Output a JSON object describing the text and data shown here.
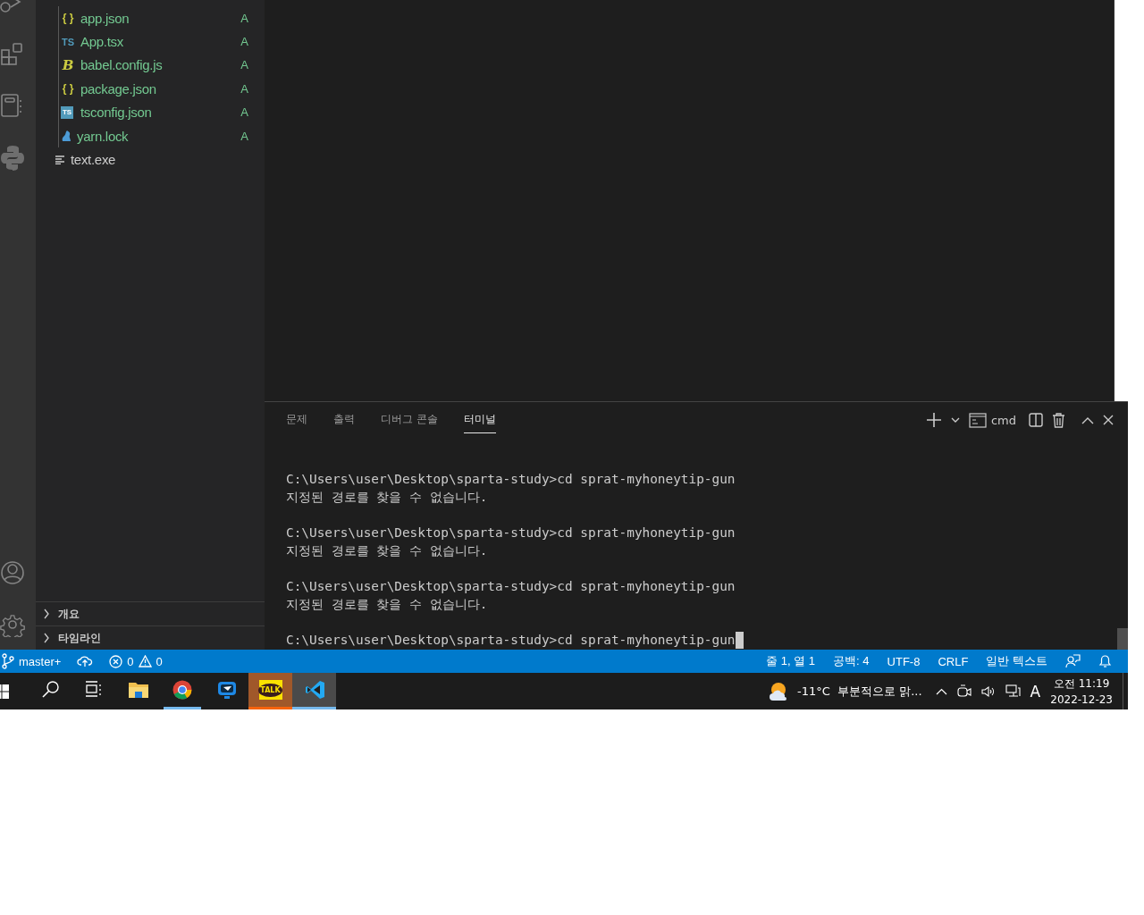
{
  "explorer": {
    "files": [
      {
        "name": "app.json",
        "kind": "json",
        "icon_text": "{ }",
        "git_status": "A"
      },
      {
        "name": "App.tsx",
        "kind": "ts",
        "icon_text": "TS",
        "git_status": "A"
      },
      {
        "name": "babel.config.js",
        "kind": "babel",
        "icon_text": "B",
        "git_status": "A"
      },
      {
        "name": "package.json",
        "kind": "json",
        "icon_text": "{ }",
        "git_status": "A"
      },
      {
        "name": "tsconfig.json",
        "kind": "tsconfig",
        "icon_text": "TS",
        "git_status": "A"
      },
      {
        "name": "yarn.lock",
        "kind": "yarn",
        "git_status": "A"
      }
    ],
    "root_files": [
      {
        "name": "text.exe",
        "kind": "text"
      }
    ],
    "sections": [
      {
        "label": "개요",
        "expanded": false
      },
      {
        "label": "타임라인",
        "expanded": false
      }
    ]
  },
  "panel": {
    "tabs": [
      {
        "label": "문제",
        "selected": false
      },
      {
        "label": "출력",
        "selected": false
      },
      {
        "label": "디버그 콘솔",
        "selected": false
      },
      {
        "label": "터미널",
        "selected": true
      }
    ],
    "shell": "cmd",
    "terminal_lines": [
      {
        "kind": "command",
        "text": "C:\\Users\\user\\Desktop\\sparta-study>cd sprat-myhoneytip-gun"
      },
      {
        "kind": "output",
        "text": "지정된 경로를 찾을 수 없습니다."
      },
      {
        "kind": "command",
        "text": "C:\\Users\\user\\Desktop\\sparta-study>cd sprat-myhoneytip-gun"
      },
      {
        "kind": "output",
        "text": "지정된 경로를 찾을 수 없습니다."
      },
      {
        "kind": "command",
        "text": "C:\\Users\\user\\Desktop\\sparta-study>cd sprat-myhoneytip-gun"
      },
      {
        "kind": "output",
        "text": "지정된 경로를 찾을 수 없습니다."
      },
      {
        "kind": "prompt",
        "text": "C:\\Users\\user\\Desktop\\sparta-study>cd sprat-myhoneytip-gun"
      }
    ]
  },
  "status_bar": {
    "branch": "master+",
    "errors": "0",
    "warnings": "0",
    "right_items": [
      "줄 1, 열 1",
      "공백: 4",
      "UTF-8",
      "CRLF",
      "일반 텍스트"
    ]
  },
  "taskbar": {
    "apps": [
      {
        "kind": "search",
        "running": false,
        "flashing": false,
        "selected": false
      },
      {
        "kind": "taskview",
        "running": false,
        "flashing": false,
        "selected": false
      },
      {
        "kind": "folder",
        "running": false,
        "flashing": false,
        "selected": false
      },
      {
        "kind": "chrome",
        "running": true,
        "flashing": false,
        "selected": false
      },
      {
        "kind": "remote",
        "running": false,
        "flashing": false,
        "selected": false
      },
      {
        "kind": "talk",
        "running": true,
        "flashing": true,
        "selected": false,
        "label": "TALK"
      },
      {
        "kind": "vscode",
        "running": true,
        "flashing": false,
        "selected": true
      }
    ],
    "weather": "-11°C  부분적으로 맑...",
    "ime": "A",
    "time": "오전 11:19",
    "date": "2022-12-23"
  }
}
